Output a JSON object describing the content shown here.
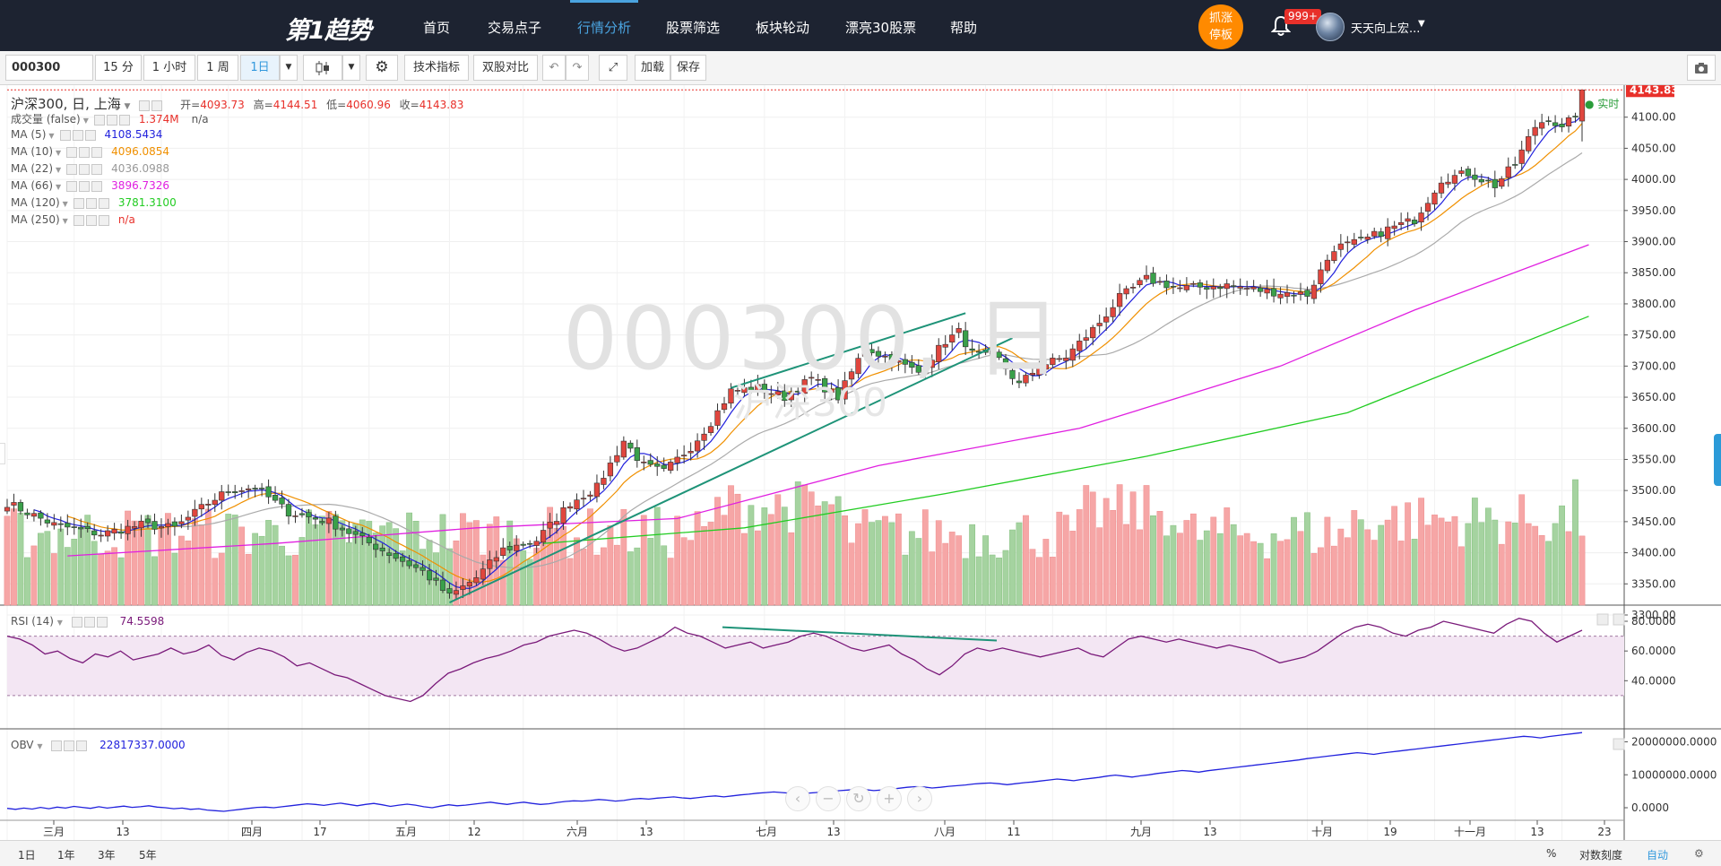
{
  "nav": {
    "logo": "第1趋势",
    "items": [
      "首页",
      "交易点子",
      "行情分析",
      "股票筛选",
      "板块轮动",
      "漂亮30股票",
      "帮助"
    ],
    "active_index": 2,
    "limit_button": [
      "抓涨",
      "停板"
    ],
    "badge": "999+",
    "username": "天天向上宏..."
  },
  "toolbar": {
    "symbol": "000300",
    "periods": [
      "15 分",
      "1 小时",
      "1 周",
      "1日"
    ],
    "active_period": "1日",
    "buttons": [
      "技术指标",
      "双股对比",
      "加载",
      "保存"
    ]
  },
  "header": {
    "title": "沪深300, 日, 上海",
    "open_label": "开=",
    "open": "4093.73",
    "high_label": "高=",
    "high": "4144.51",
    "low_label": "低=",
    "low": "4060.96",
    "close_label": "收=",
    "close": "4143.83",
    "realtime": "实时"
  },
  "indicators": [
    {
      "label": "成交量 (false)",
      "value": "1.374M",
      "value2": "n/a",
      "color": "#e8302a"
    },
    {
      "label": "MA (5)",
      "value": "4108.5434",
      "color": "#2222dd"
    },
    {
      "label": "MA (10)",
      "value": "4096.0854",
      "color": "#f09000"
    },
    {
      "label": "MA (22)",
      "value": "4036.0988",
      "color": "#999999"
    },
    {
      "label": "MA (66)",
      "value": "3896.7326",
      "color": "#e020e0"
    },
    {
      "label": "MA (120)",
      "value": "3781.3100",
      "color": "#22cc22"
    },
    {
      "label": "MA (250)",
      "value": "n/a",
      "color": "#e8302a"
    }
  ],
  "watermark": {
    "symbol": "000300",
    "period": "日",
    "name": "沪深300"
  },
  "rsi": {
    "label": "RSI (14)",
    "value": "74.5598",
    "color": "#7a1a7a"
  },
  "obv": {
    "label": "OBV",
    "value": "22817337.0000",
    "color": "#2222dd"
  },
  "last_price_tag": "4143.83",
  "bottombar": {
    "ranges": [
      "1日",
      "1年",
      "3年",
      "5年"
    ],
    "right": [
      "%",
      "对数刻度",
      "自动"
    ],
    "active_right": "自动"
  },
  "colors": {
    "up": "#e8302a",
    "down": "#2a9d3a",
    "vol_up": "#f6a6a6",
    "vol_down": "#a5d3a0",
    "nav_bg": "#1d2331",
    "accent": "#3399dd"
  },
  "chart_data": {
    "type": "candlestick",
    "symbol": "000300",
    "period": "日",
    "y_axis": {
      "min": 3300,
      "max": 4100,
      "ticks": [
        3300,
        3350,
        3400,
        3450,
        3500,
        3550,
        3600,
        3650,
        3700,
        3750,
        3800,
        3850,
        3900,
        3950,
        4000,
        4050,
        4100
      ]
    },
    "x_axis_labels": [
      "三月",
      "13",
      "四月",
      "17",
      "五月",
      "12",
      "六月",
      "13",
      "七月",
      "13",
      "八月",
      "11",
      "九月",
      "13",
      "十月",
      "19",
      "十一月",
      "13",
      "23"
    ],
    "anchors": [
      {
        "i": 0,
        "v": 3480
      },
      {
        "i": 7,
        "v": 3445
      },
      {
        "i": 14,
        "v": 3430
      },
      {
        "i": 20,
        "v": 3445
      },
      {
        "i": 25,
        "v": 3440
      },
      {
        "i": 30,
        "v": 3480
      },
      {
        "i": 33,
        "v": 3500
      },
      {
        "i": 37,
        "v": 3505
      },
      {
        "i": 42,
        "v": 3465
      },
      {
        "i": 48,
        "v": 3450
      },
      {
        "i": 55,
        "v": 3410
      },
      {
        "i": 62,
        "v": 3370
      },
      {
        "i": 66,
        "v": 3330
      },
      {
        "i": 70,
        "v": 3360
      },
      {
        "i": 74,
        "v": 3405
      },
      {
        "i": 79,
        "v": 3420
      },
      {
        "i": 84,
        "v": 3480
      },
      {
        "i": 88,
        "v": 3505
      },
      {
        "i": 92,
        "v": 3580
      },
      {
        "i": 95,
        "v": 3540
      },
      {
        "i": 98,
        "v": 3530
      },
      {
        "i": 102,
        "v": 3570
      },
      {
        "i": 105,
        "v": 3610
      },
      {
        "i": 108,
        "v": 3660
      },
      {
        "i": 112,
        "v": 3665
      },
      {
        "i": 116,
        "v": 3650
      },
      {
        "i": 120,
        "v": 3680
      },
      {
        "i": 124,
        "v": 3650
      },
      {
        "i": 128,
        "v": 3730
      },
      {
        "i": 132,
        "v": 3710
      },
      {
        "i": 136,
        "v": 3690
      },
      {
        "i": 140,
        "v": 3740
      },
      {
        "i": 142,
        "v": 3755
      },
      {
        "i": 144,
        "v": 3720
      },
      {
        "i": 148,
        "v": 3710
      },
      {
        "i": 151,
        "v": 3670
      },
      {
        "i": 154,
        "v": 3700
      },
      {
        "i": 158,
        "v": 3715
      },
      {
        "i": 163,
        "v": 3770
      },
      {
        "i": 166,
        "v": 3810
      },
      {
        "i": 170,
        "v": 3840
      },
      {
        "i": 175,
        "v": 3825
      },
      {
        "i": 182,
        "v": 3830
      },
      {
        "i": 188,
        "v": 3820
      },
      {
        "i": 194,
        "v": 3815
      },
      {
        "i": 198,
        "v": 3890
      },
      {
        "i": 202,
        "v": 3900
      },
      {
        "i": 206,
        "v": 3920
      },
      {
        "i": 210,
        "v": 3935
      },
      {
        "i": 214,
        "v": 4000
      },
      {
        "i": 218,
        "v": 4010
      },
      {
        "i": 222,
        "v": 3990
      },
      {
        "i": 225,
        "v": 4025
      },
      {
        "i": 228,
        "v": 4085
      },
      {
        "i": 230,
        "v": 4100
      },
      {
        "i": 232,
        "v": 4080
      },
      {
        "i": 234,
        "v": 4105
      },
      {
        "i": 235,
        "v": 4143.83
      }
    ],
    "ma_series": [
      {
        "name": "MA (66)",
        "points": [
          [
            9,
            3395
          ],
          [
            40,
            3415
          ],
          [
            70,
            3440
          ],
          [
            100,
            3455
          ],
          [
            130,
            3540
          ],
          [
            160,
            3600
          ],
          [
            190,
            3700
          ],
          [
            210,
            3790
          ],
          [
            236,
            3895
          ]
        ]
      },
      {
        "name": "MA (120)",
        "points": [
          [
            80,
            3415
          ],
          [
            110,
            3440
          ],
          [
            140,
            3495
          ],
          [
            170,
            3555
          ],
          [
            200,
            3625
          ],
          [
            236,
            3780
          ]
        ]
      }
    ],
    "trendlines": [
      {
        "from": [
          108,
          3665
        ],
        "to": [
          143,
          3785
        ]
      },
      {
        "from": [
          66,
          3320
        ],
        "to": [
          150,
          3745
        ]
      }
    ],
    "rsi_ticks": [
      40,
      60,
      80
    ],
    "rsi_band": [
      30,
      70
    ],
    "rsi_values": [
      70,
      68,
      64,
      58,
      60,
      55,
      52,
      58,
      56,
      60,
      54,
      56,
      58,
      62,
      58,
      60,
      64,
      57,
      54,
      59,
      62,
      60,
      56,
      50,
      52,
      48,
      44,
      42,
      38,
      34,
      30,
      28,
      26,
      30,
      38,
      45,
      48,
      52,
      55,
      57,
      60,
      64,
      66,
      70,
      72,
      74,
      72,
      68,
      63,
      60,
      62,
      66,
      70,
      76,
      72,
      70,
      66,
      62,
      64,
      66,
      62,
      64,
      66,
      70,
      72,
      70,
      66,
      62,
      60,
      62,
      64,
      58,
      54,
      48,
      44,
      50,
      58,
      62,
      60,
      62,
      60,
      58,
      56,
      58,
      60,
      62,
      58,
      56,
      62,
      68,
      70,
      68,
      66,
      68,
      66,
      64,
      62,
      64,
      62,
      60,
      56,
      52,
      54,
      56,
      60,
      66,
      72,
      76,
      78,
      76,
      72,
      70,
      74,
      76,
      80,
      78,
      76,
      74,
      72,
      78,
      82,
      80,
      72,
      66,
      70,
      74
    ],
    "obv_ticks": [
      0,
      10000000,
      20000000
    ],
    "obv_values": [
      -0.2,
      -0.5,
      -0.1,
      -0.4,
      0.1,
      -0.3,
      0.2,
      -0.1,
      0.4,
      0.1,
      -0.2,
      0.3,
      -0.1,
      0.2,
      0.5,
      0.1,
      0.3,
      0.6,
      0.2,
      0.0,
      -0.3,
      -0.1,
      -0.5,
      -0.3,
      -0.7,
      -0.9,
      -1.1,
      -0.8,
      -0.5,
      -0.2,
      0.1,
      0.2,
      0.0,
      0.3,
      0.6,
      0.9,
      1.2,
      1.0,
      0.7,
      1.1,
      1.4,
      1.0,
      0.6,
      1.0,
      1.3,
      0.9,
      0.4,
      0.8,
      1.1,
      0.8,
      0.3,
      0.0,
      0.5,
      0.9,
      0.6,
      0.8,
      1.1,
      1.4,
      1.7,
      1.3,
      1.0,
      1.4,
      1.7,
      1.3,
      1.0,
      1.2,
      1.6,
      1.9,
      2.1,
      2.0,
      2.2,
      2.5,
      2.3,
      2.0,
      2.2,
      2.6,
      2.8,
      2.6,
      2.9,
      3.1,
      3.3,
      3.0,
      2.8,
      3.1,
      3.4,
      3.6,
      3.3,
      3.6,
      3.9,
      4.1,
      4.4,
      4.6,
      4.8,
      4.6,
      4.4,
      4.2,
      4.4,
      4.6,
      4.8,
      5.0,
      5.2,
      5.4,
      5.6,
      5.5,
      5.2,
      5.4,
      5.6,
      5.9,
      6.2,
      6.4,
      6.3,
      6.0,
      6.2,
      6.5,
      6.7,
      6.9,
      7.2,
      7.4,
      7.5,
      7.3,
      7.0,
      7.3,
      7.6,
      7.8,
      8.1,
      8.4,
      8.7,
      8.5,
      8.2,
      8.6,
      8.9,
      9.2,
      9.6,
      9.9,
      9.6,
      9.3,
      9.7,
      10.0,
      10.4,
      10.7,
      11.0,
      11.3,
      11.1,
      10.8,
      11.2,
      11.5,
      11.8,
      12.1,
      12.4,
      12.7,
      13.0,
      13.3,
      13.6,
      13.9,
      14.2,
      14.5,
      14.9,
      15.2,
      15.5,
      15.8,
      16.1,
      16.4,
      16.7,
      16.5,
      16.2,
      16.6,
      16.9,
      17.2,
      17.5,
      17.8,
      18.1,
      18.4,
      18.7,
      19.0,
      19.3,
      19.6,
      19.9,
      20.2,
      20.5,
      20.8,
      21.1,
      21.4,
      21.7,
      21.5,
      21.2,
      21.6,
      21.9,
      22.2,
      22.5,
      22.8
    ]
  }
}
